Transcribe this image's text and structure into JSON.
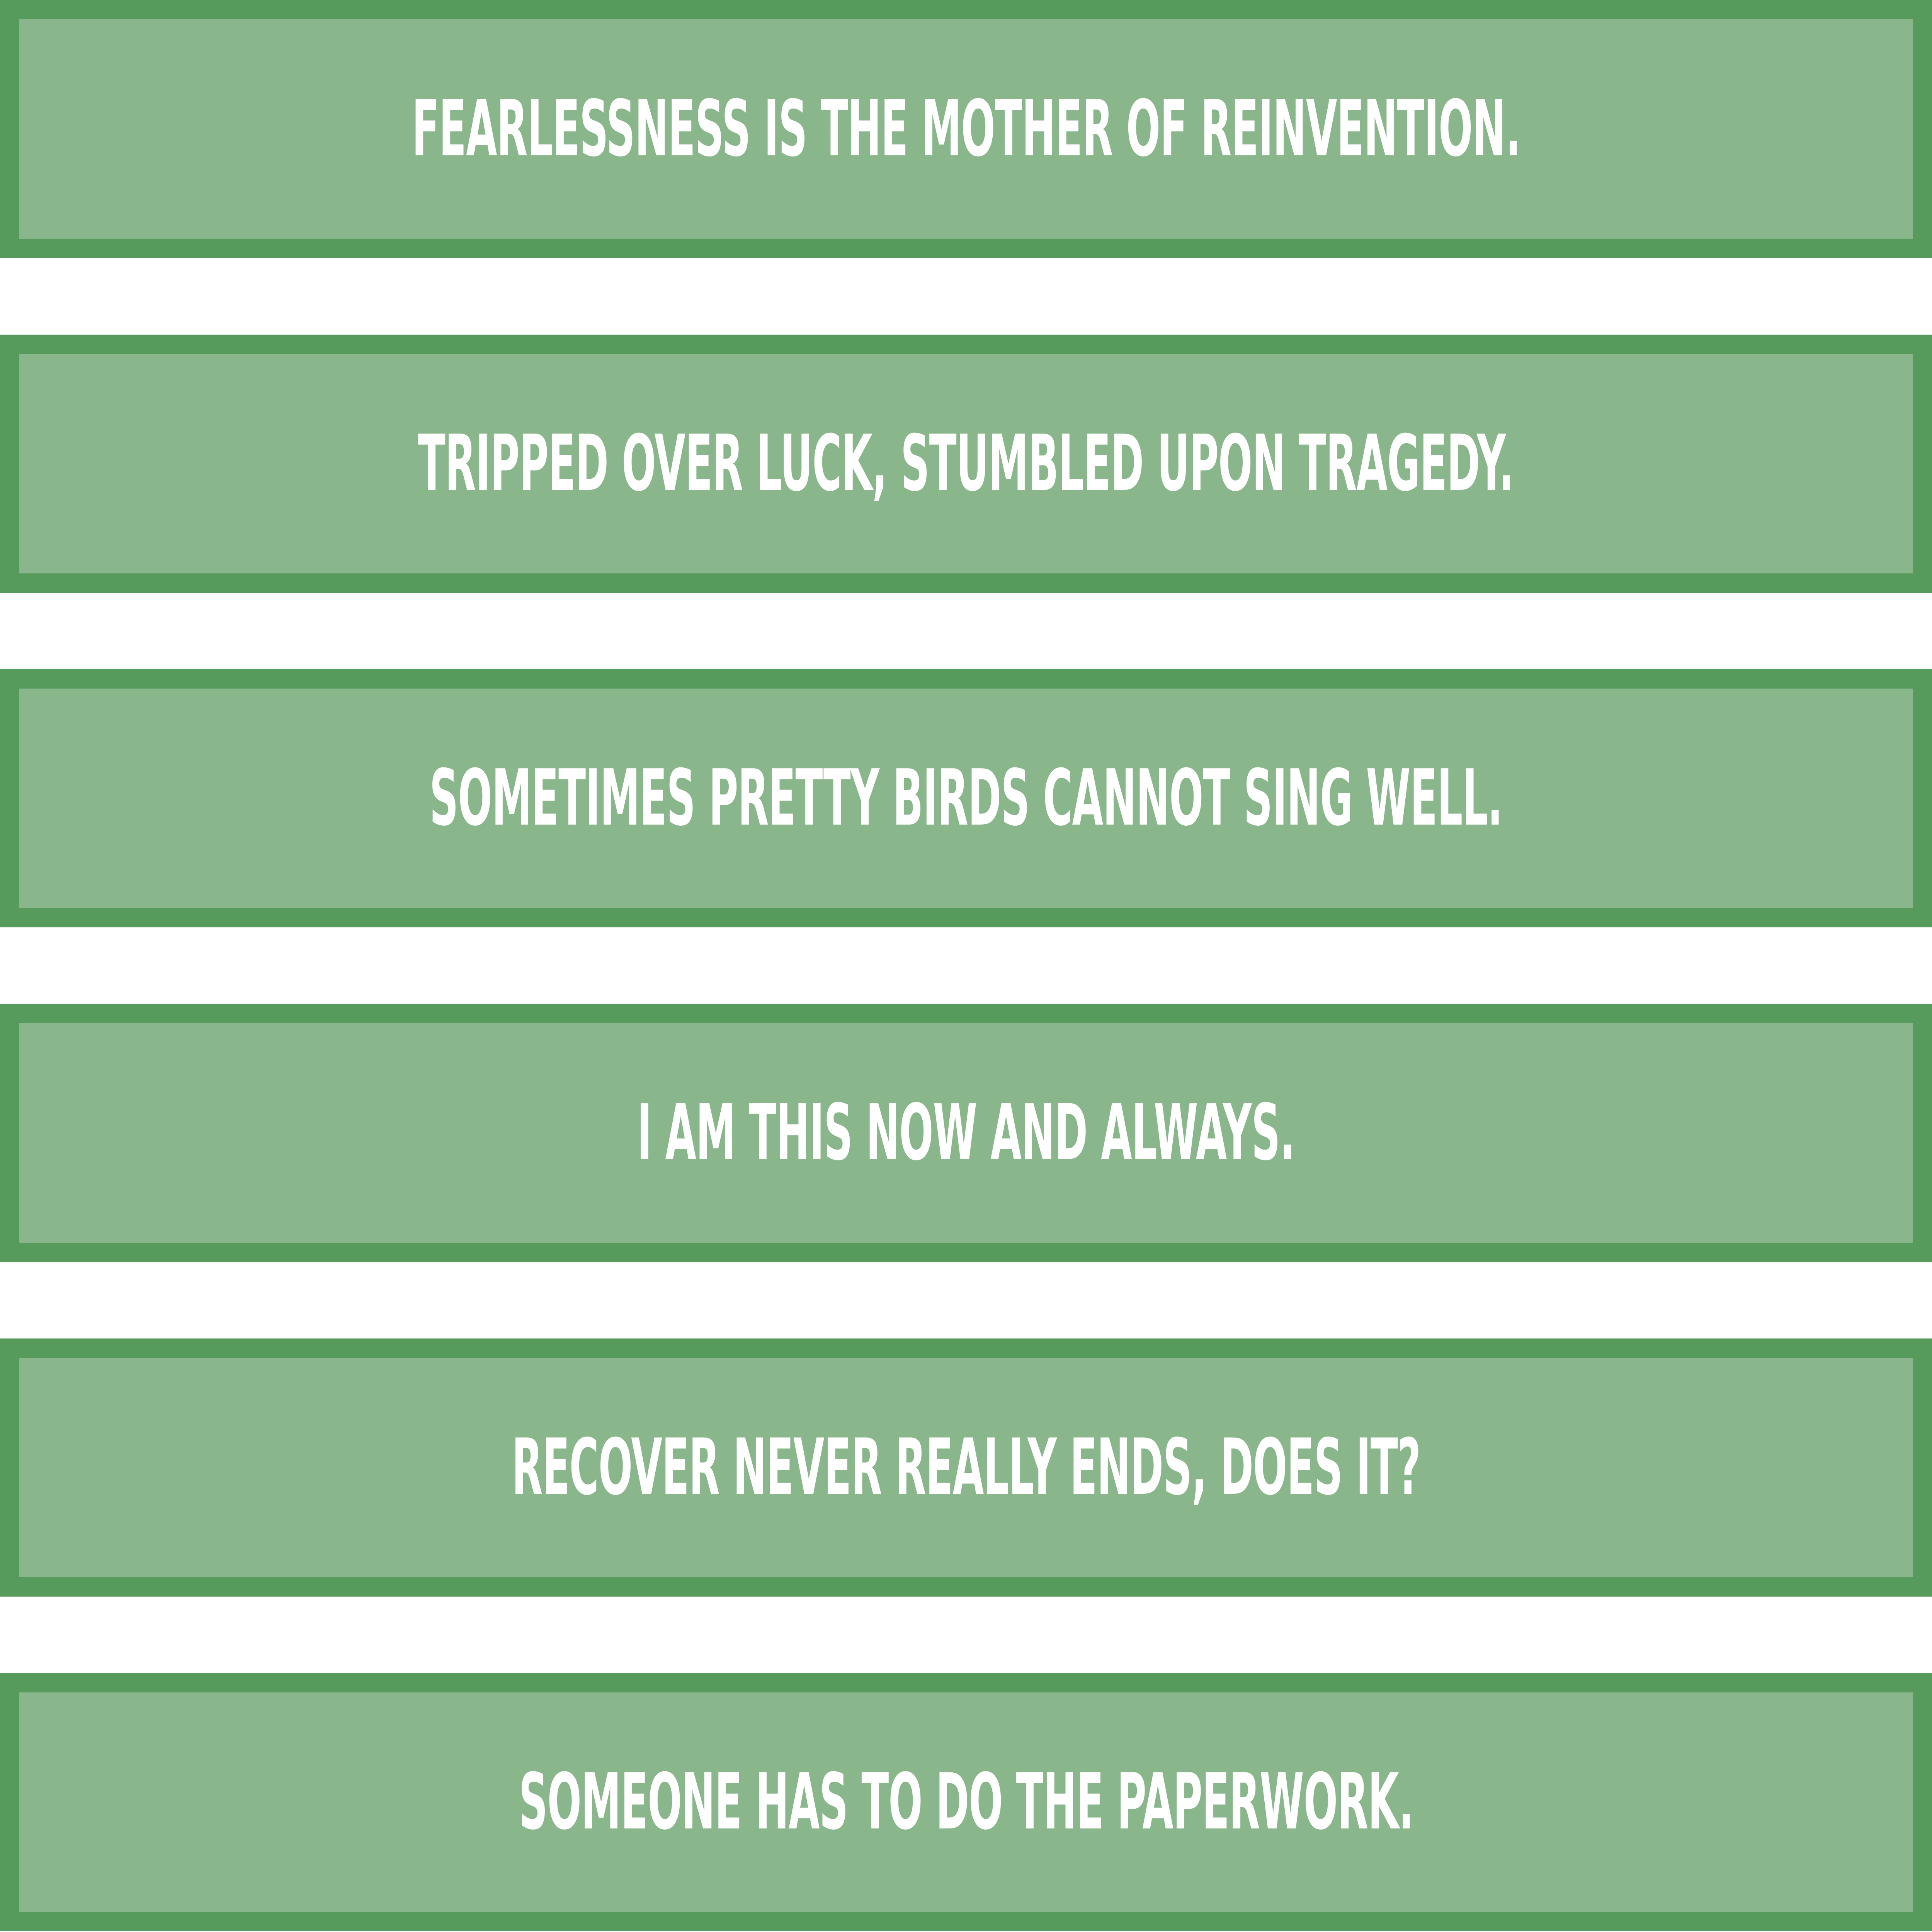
{
  "colors": {
    "border": "#569a5c",
    "fill": "#8ab68c",
    "text": "#ffffff",
    "background": "#ffffff"
  },
  "banners": [
    {
      "text": "Fearlessness is the mother of reinvention."
    },
    {
      "text": "Tripped over luck, stumbled upon tragedy."
    },
    {
      "text": "Sometimes pretty birds cannot sing well."
    },
    {
      "text": "I am this now and always."
    },
    {
      "text": "Recover never really ends, does it?"
    },
    {
      "text": "Someone has to do the paperwork."
    }
  ]
}
